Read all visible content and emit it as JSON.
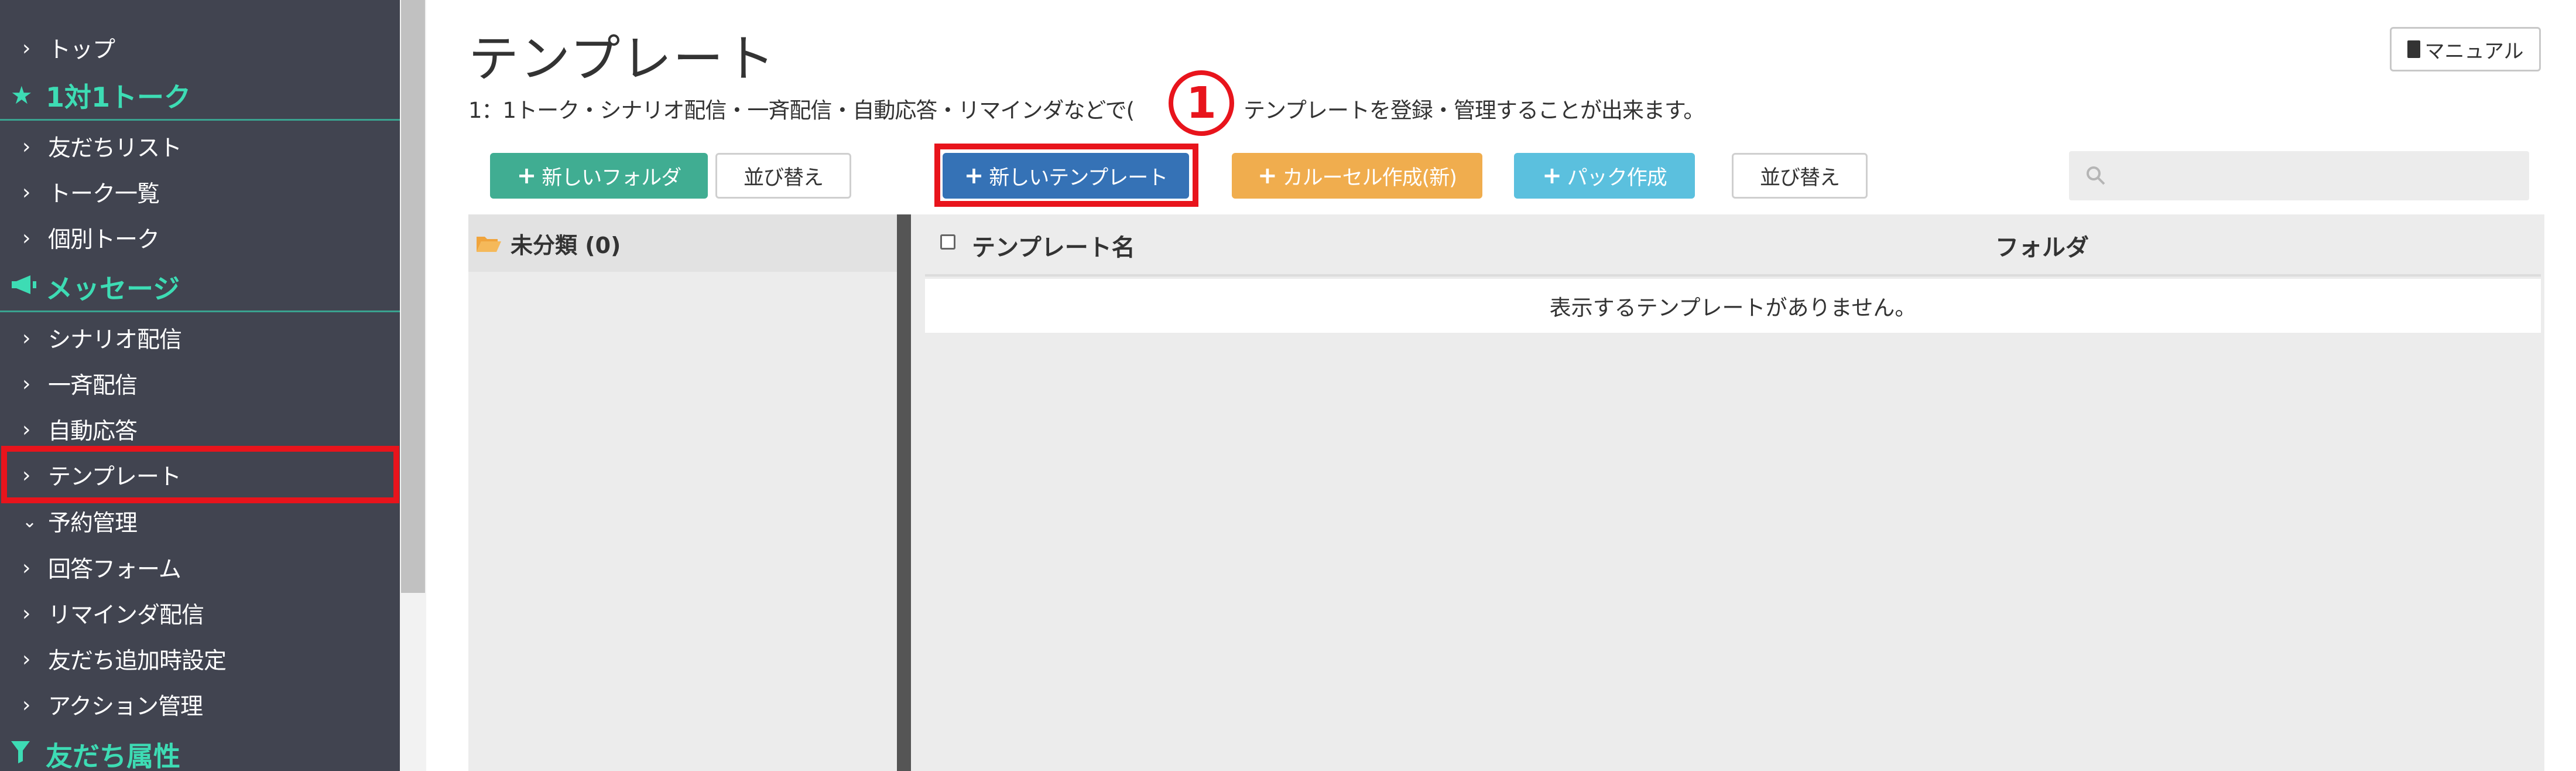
{
  "sidebar": {
    "items": [
      {
        "type": "link",
        "label": "トップ"
      },
      {
        "type": "section",
        "label": "1対1トーク",
        "icon": "star-icon"
      },
      {
        "type": "link",
        "label": "友だちリスト"
      },
      {
        "type": "link",
        "label": "トーク一覧"
      },
      {
        "type": "link",
        "label": "個別トーク"
      },
      {
        "type": "section",
        "label": "メッセージ",
        "icon": "megaphone-icon"
      },
      {
        "type": "link",
        "label": "シナリオ配信"
      },
      {
        "type": "link",
        "label": "一斉配信"
      },
      {
        "type": "link",
        "label": "自動応答"
      },
      {
        "type": "link",
        "label": "テンプレート",
        "selected": true
      },
      {
        "type": "link",
        "label": "予約管理",
        "expanded": true
      },
      {
        "type": "link",
        "label": "回答フォーム"
      },
      {
        "type": "link",
        "label": "リマインダ配信"
      },
      {
        "type": "link",
        "label": "友だち追加時設定"
      },
      {
        "type": "link",
        "label": "アクション管理"
      },
      {
        "type": "section",
        "label": "友だち属性",
        "icon": "filter-icon"
      }
    ]
  },
  "header": {
    "title": "テンプレート",
    "description_left": "1：1トーク・シナリオ配信・一斉配信・自動応答・リマインダなどで(",
    "description_right": "テンプレートを登録・管理することが出来ます。",
    "step_marker": "1",
    "manual_label": "マニュアル"
  },
  "toolbar": {
    "new_folder": "新しいフォルダ",
    "sort_1": "並び替え",
    "new_template": "新しいテンプレート",
    "carousel": "カルーセル作成(新)",
    "pack": "パック作成",
    "sort_2": "並び替え",
    "search_placeholder": ""
  },
  "folders": [
    {
      "label": "未分類 (0)"
    }
  ],
  "table": {
    "columns": [
      "テンプレート名",
      "フォルダ"
    ],
    "empty_message": "表示するテンプレートがありません。"
  },
  "colors": {
    "sidebar_bg": "#414450",
    "accent_green": "#3ddcb4",
    "highlight_red": "#e8141c",
    "new_folder_btn": "#40ad92",
    "new_template_btn": "#3572b6",
    "carousel_btn": "#f0ad4e",
    "pack_btn": "#5bc0de"
  }
}
